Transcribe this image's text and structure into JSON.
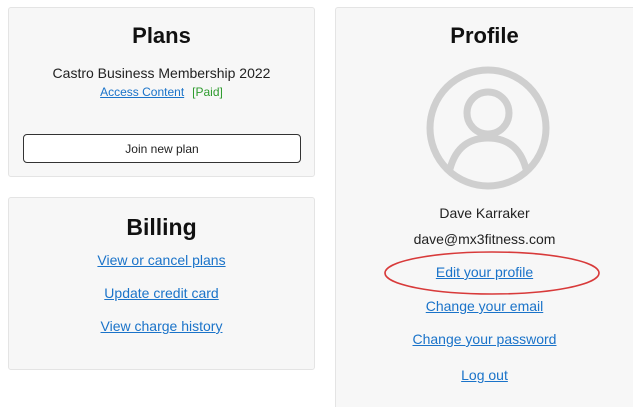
{
  "plans": {
    "title": "Plans",
    "plan_name": "Castro Business Membership 2022",
    "access_link": "Access Content",
    "status": "[Paid]",
    "join_button": "Join new plan"
  },
  "billing": {
    "title": "Billing",
    "links": [
      "View or cancel plans",
      "Update credit card",
      "View charge history"
    ]
  },
  "profile": {
    "title": "Profile",
    "avatar_icon": "user-avatar-icon",
    "name": "Dave Karraker",
    "email": "dave@mx3fitness.com",
    "links": {
      "edit": "Edit your profile",
      "change_email": "Change your email",
      "change_password": "Change your password",
      "logout": "Log out"
    }
  },
  "colors": {
    "link": "#1a73c9",
    "paid": "#2e9b2e",
    "highlight": "#d83a3a",
    "panel_bg": "#f7f7f7"
  }
}
